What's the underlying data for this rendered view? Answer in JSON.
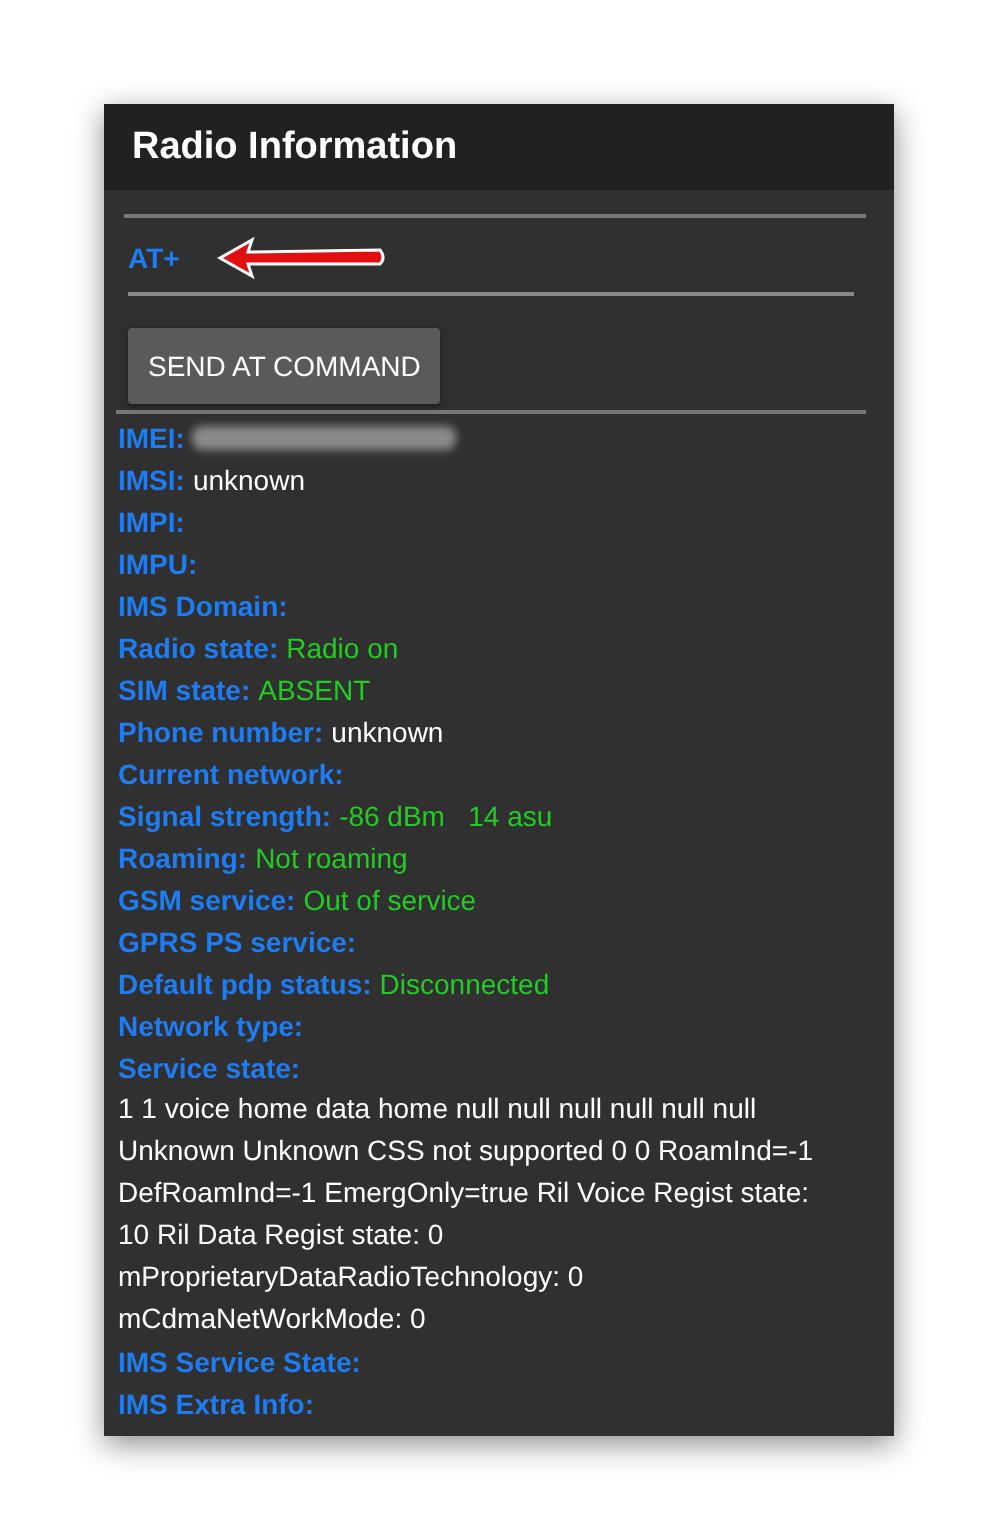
{
  "app_bar": {
    "title": "Radio Information"
  },
  "command_field": {
    "value": "AT+"
  },
  "send_button": {
    "label": "SEND AT COMMAND"
  },
  "info_rows": [
    {
      "label": "IMEI:",
      "redacted": true
    },
    {
      "label": "IMSI:",
      "value": "unknown",
      "kind": "plain"
    },
    {
      "label": "IMPI:"
    },
    {
      "label": "IMPU:"
    },
    {
      "label": "IMS Domain:"
    },
    {
      "label": "Radio state:",
      "value": "Radio on",
      "kind": "status"
    },
    {
      "label": "SIM state:",
      "value": "ABSENT",
      "kind": "status"
    },
    {
      "label": "Phone number:",
      "value": "unknown",
      "kind": "plain"
    },
    {
      "label": "Current network:"
    },
    {
      "label": "Signal strength:",
      "value": "-86 dBm   14 asu",
      "kind": "status"
    },
    {
      "label": "Roaming:",
      "value": "Not roaming",
      "kind": "status"
    },
    {
      "label": "GSM service:",
      "value": "Out of service",
      "kind": "status"
    },
    {
      "label": "GPRS PS service:"
    },
    {
      "label": "Default pdp status:",
      "value": "Disconnected",
      "kind": "status"
    },
    {
      "label": "Network type:"
    },
    {
      "label": "Service state:",
      "value": "1 1 voice home data home null null null null null null Unknown Unknown CSS not supported 0 0 RoamInd=-1 DefRoamInd=-1 EmergOnly=true Ril Voice Regist state: 10 Ril Data Regist state: 0\nmProprietaryDataRadioTechnology: 0\nmCdmaNetWorkMode: 0",
      "kind": "paragraph"
    },
    {
      "label": "IMS Service State:"
    },
    {
      "label": "IMS Extra Info:"
    }
  ]
}
